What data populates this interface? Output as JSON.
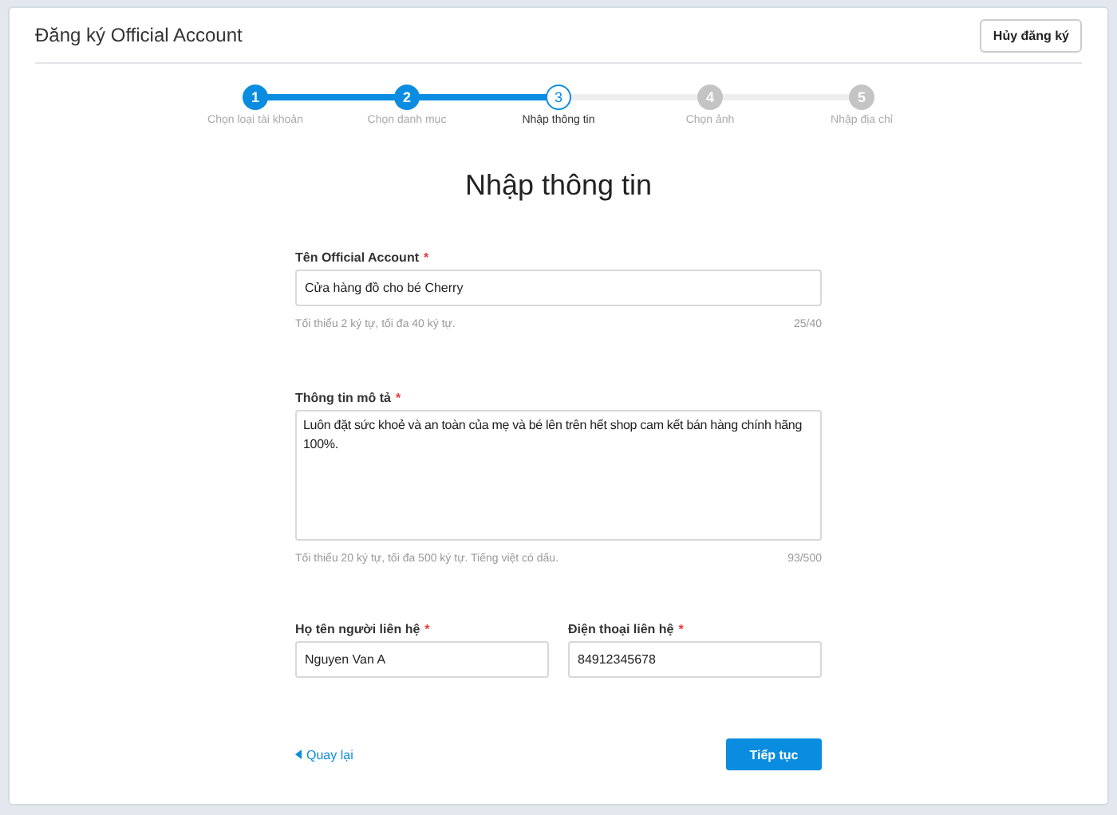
{
  "header": {
    "title": "Đăng ký Official Account",
    "cancel_button": "Hủy đăng ký"
  },
  "steps": [
    {
      "number": "1",
      "label": "Chọn loại tài khoản",
      "kind": "done"
    },
    {
      "number": "2",
      "label": "Chọn danh mục",
      "kind": "done"
    },
    {
      "number": "3",
      "label": "Nhập thông tin",
      "kind": "current"
    },
    {
      "number": "4",
      "label": "Chọn ảnh",
      "kind": "todo"
    },
    {
      "number": "5",
      "label": "Nhập địa chỉ",
      "kind": "todo"
    }
  ],
  "heading": "Nhập thông tin",
  "fields": [
    {
      "kind": "text",
      "label": "Tên Official Account",
      "required_mark": "*",
      "value": "Cửa hàng đồ cho bé Cherry",
      "hint": "Tối thiểu 2 ký tự, tối đa 40 ký tự.",
      "counter": "25/40"
    },
    {
      "kind": "textarea",
      "label": "Thông tin mô tả",
      "required_mark": "*",
      "value": "Luôn đặt sức khoẻ và an toàn của mẹ và bé lên trên hết shop cam kết bán hàng chính hãng 100%.",
      "hint": "Tối thiểu 20 ký tự, tối đa 500 ký tự. Tiếng việt có dấu.",
      "counter": "93/500"
    }
  ],
  "contact_fields": [
    {
      "label": "Họ tên người liên hệ",
      "required_mark": "*",
      "value": "Nguyen Van A"
    },
    {
      "label": "Điện thoại liên hệ",
      "required_mark": "*",
      "value": "84912345678"
    }
  ],
  "back_link": "Quay lại",
  "next_button": "Tiếp tục"
}
